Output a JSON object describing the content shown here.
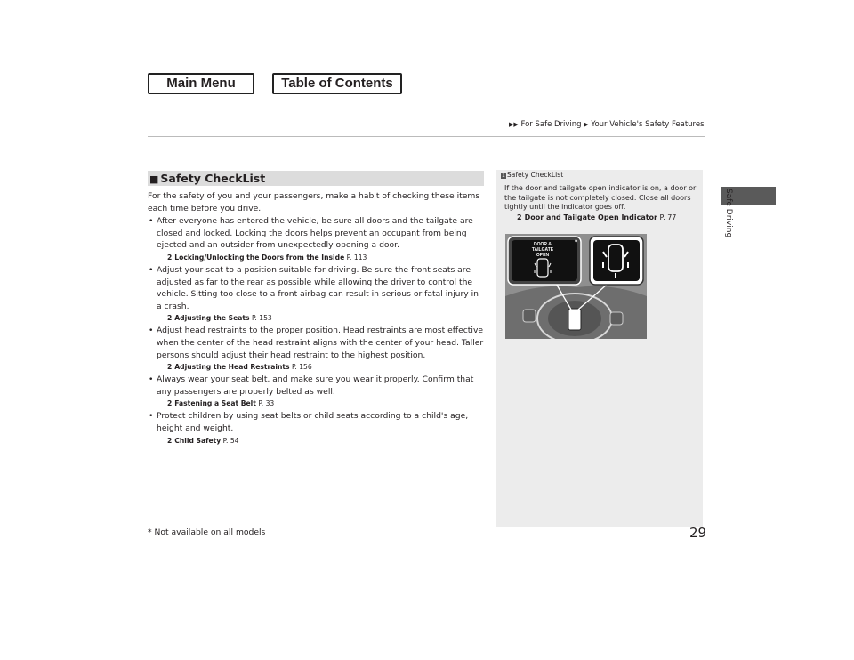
{
  "nav": {
    "main_menu": "Main Menu",
    "table_of_contents": "Table of Contents"
  },
  "breadcrumb": {
    "parent": "For Safe Driving",
    "current": "Your Vehicle's Safety Features"
  },
  "side_tab": {
    "label": "Safe Driving"
  },
  "section": {
    "title": "Safety CheckList",
    "intro": "For the safety of you and your passengers, make a habit of checking these items each time before you drive.",
    "bullets": [
      {
        "text": "After everyone has entered the vehicle, be sure all doors and the tailgate are closed and locked. Locking the doors helps prevent an occupant from being ejected and an outsider from unexpectedly opening a door.",
        "ref_title": "Locking/Unlocking the Doors from the Inside",
        "ref_page": "P. 113"
      },
      {
        "text": "Adjust your seat to a position suitable for driving. Be sure the front seats are adjusted as far to the rear as possible while allowing the driver to control the vehicle. Sitting too close to a front airbag can result in serious or fatal injury in a crash.",
        "ref_title": "Adjusting the Seats",
        "ref_page": "P. 153"
      },
      {
        "text": "Adjust head restraints to the proper position. Head restraints are most effective when the center of the head restraint aligns with the center of your head. Taller persons should adjust their head restraint to the highest position.",
        "ref_title": "Adjusting the Head Restraints",
        "ref_page": "P. 156"
      },
      {
        "text": "Always wear your seat belt, and make sure you wear it properly. Confirm that any passengers are properly belted as well.",
        "ref_title": "Fastening a Seat Belt",
        "ref_page": "P. 33"
      },
      {
        "text": "Protect children by using seat belts or child seats according to a child's age, height and weight.",
        "ref_title": "Child Safety",
        "ref_page": "P. 54"
      }
    ]
  },
  "sidebar": {
    "num": "1",
    "title": "Safety CheckList",
    "text": "If the door and tailgate open indicator is on, a door or the tailgate is not completely closed. Close all doors tightly until the indicator goes off.",
    "ref_title": "Door and Tailgate Open Indicator",
    "ref_page": "P. 77",
    "figure": {
      "indicator_text": "DOOR & TAILGATE OPEN",
      "asterisk": "*"
    }
  },
  "footnote": "* Not available on all models",
  "page_number": "29",
  "glyphs": {
    "arrow": "▶▶",
    "arrow_single": "▶",
    "square": "■",
    "bullet": "•",
    "ref": "2"
  }
}
